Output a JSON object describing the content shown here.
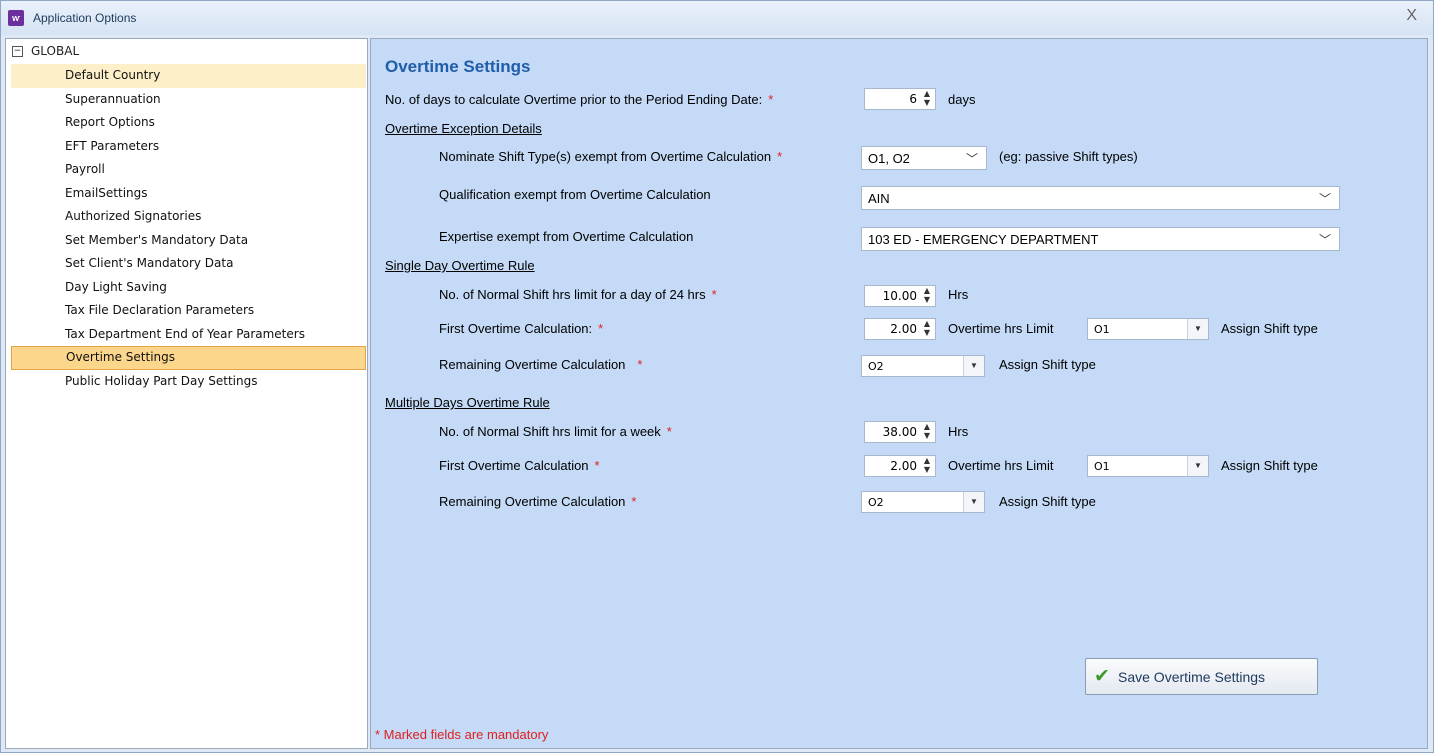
{
  "window": {
    "title": "Application Options",
    "icon": "app-logo-icon",
    "close_glyph": "X"
  },
  "tree": {
    "root": {
      "label": "GLOBAL",
      "expander": "−"
    },
    "items": [
      "Default Country",
      "Superannuation",
      "Report Options",
      "EFT Parameters",
      "Payroll",
      "EmailSettings",
      "Authorized Signatories",
      "Set Member's Mandatory Data",
      "Set Client's Mandatory Data",
      "Day Light Saving",
      "Tax File Declaration Parameters",
      "Tax Department End of Year Parameters",
      "Overtime Settings",
      "Public Holiday Part Day Settings"
    ],
    "selected": "Overtime Settings",
    "hovered": "Default Country"
  },
  "form": {
    "title": "Overtime Settings",
    "days_prior": {
      "label": "No. of days to calculate Overtime prior to the Period Ending Date:",
      "value": "6",
      "unit": "days"
    },
    "exception": {
      "heading": "Overtime Exception Details",
      "shift_types": {
        "label": "Nominate Shift Type(s) exempt from Overtime Calculation",
        "value": "O1, O2",
        "hint": "(eg: passive Shift types)"
      },
      "qualification": {
        "label": "Qualification exempt from Overtime Calculation",
        "value": "AIN"
      },
      "expertise": {
        "label": "Expertise exempt from Overtime Calculation",
        "value": "103 ED - EMERGENCY DEPARTMENT"
      }
    },
    "single_day": {
      "heading": "Single Day Overtime Rule",
      "normal_hrs": {
        "label": "No. of Normal Shift hrs limit for a day of 24 hrs",
        "value": "10.00",
        "unit": "Hrs"
      },
      "first_ot": {
        "label": "First Overtime Calculation:",
        "value": "2.00",
        "limit_label": "Overtime hrs Limit",
        "shift": "O1",
        "assign_label": "Assign Shift type"
      },
      "remaining_ot": {
        "label": "Remaining Overtime Calculation",
        "shift": "O2",
        "assign_label": "Assign Shift type"
      }
    },
    "multi_day": {
      "heading": "Multiple Days Overtime Rule",
      "normal_hrs": {
        "label": "No. of Normal Shift hrs limit for a week",
        "value": "38.00",
        "unit": "Hrs"
      },
      "first_ot": {
        "label": "First Overtime Calculation",
        "value": "2.00",
        "limit_label": "Overtime hrs Limit",
        "shift": "O1",
        "assign_label": "Assign Shift type"
      },
      "remaining_ot": {
        "label": "Remaining Overtime Calculation",
        "shift": "O2",
        "assign_label": "Assign Shift type"
      }
    },
    "required_mark": "*",
    "save_label": "Save Overtime Settings",
    "footnote": "* Marked fields are mandatory"
  },
  "colors": {
    "accent_title": "#1f5ea8",
    "required": "#e02020",
    "selected_item": "#fbd68b",
    "panel_bg": "#c4daf6"
  }
}
